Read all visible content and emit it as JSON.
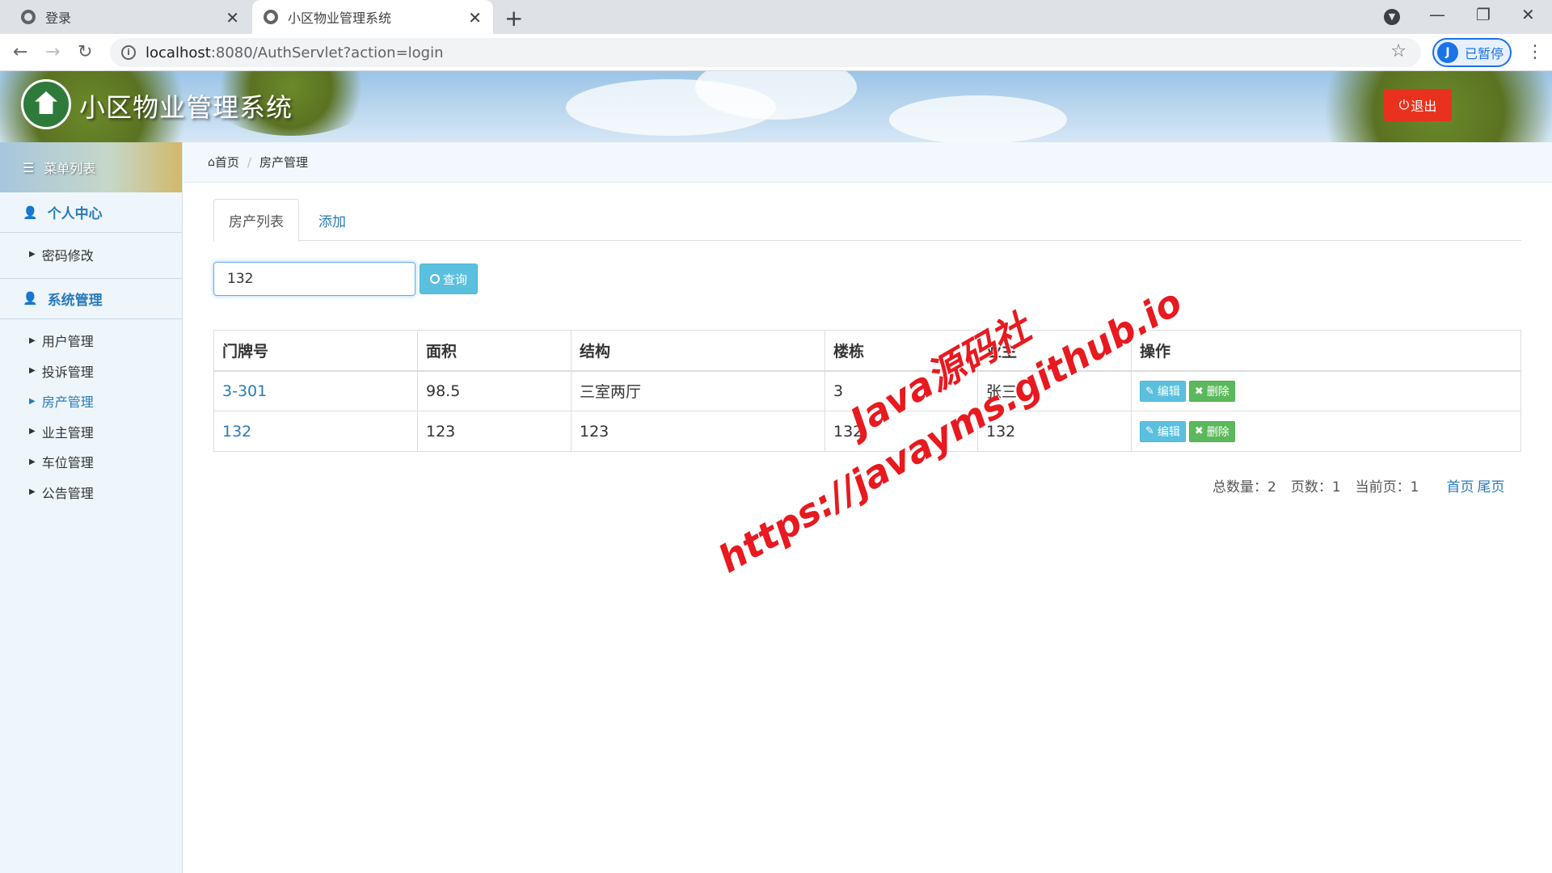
{
  "browser": {
    "tabs": [
      {
        "title": "登录"
      },
      {
        "title": "小区物业管理系统"
      }
    ],
    "url_host": "localhost",
    "url_rest": ":8080/AuthServlet?action=login",
    "profile_initial": "J",
    "profile_label": "已暂停"
  },
  "header": {
    "title": "小区物业管理系统",
    "logout_label": "退出",
    "logout_color": "#e8321e"
  },
  "sidebar": {
    "menu_title": "菜单列表",
    "groups": [
      {
        "title": "个人中心",
        "items": [
          "密码修改"
        ]
      },
      {
        "title": "系统管理",
        "items": [
          "用户管理",
          "投诉管理",
          "房产管理",
          "业主管理",
          "车位管理",
          "公告管理"
        ],
        "active": "房产管理"
      }
    ]
  },
  "breadcrumb": {
    "home": "首页",
    "current": "房产管理"
  },
  "content": {
    "tabs": [
      "房产列表",
      "添加"
    ],
    "search": {
      "value": "132",
      "button_label": "查询"
    },
    "table": {
      "headers": [
        "门牌号",
        "面积",
        "结构",
        "楼栋",
        "业主",
        "操作"
      ],
      "rows": [
        [
          "3-301",
          "98.5",
          "三室两厅",
          "3",
          "张三"
        ],
        [
          "132",
          "123",
          "123",
          "132",
          "132"
        ]
      ],
      "edit_label": "编辑",
      "delete_label": "删除"
    },
    "pager": {
      "total_label": "总数量：2",
      "pages_label": "页数：1",
      "current_label": "当前页：1",
      "first": "首页",
      "last": "尾页"
    }
  },
  "watermark": {
    "line1": "Java源码社",
    "line2": "https://javayms.github.io"
  }
}
